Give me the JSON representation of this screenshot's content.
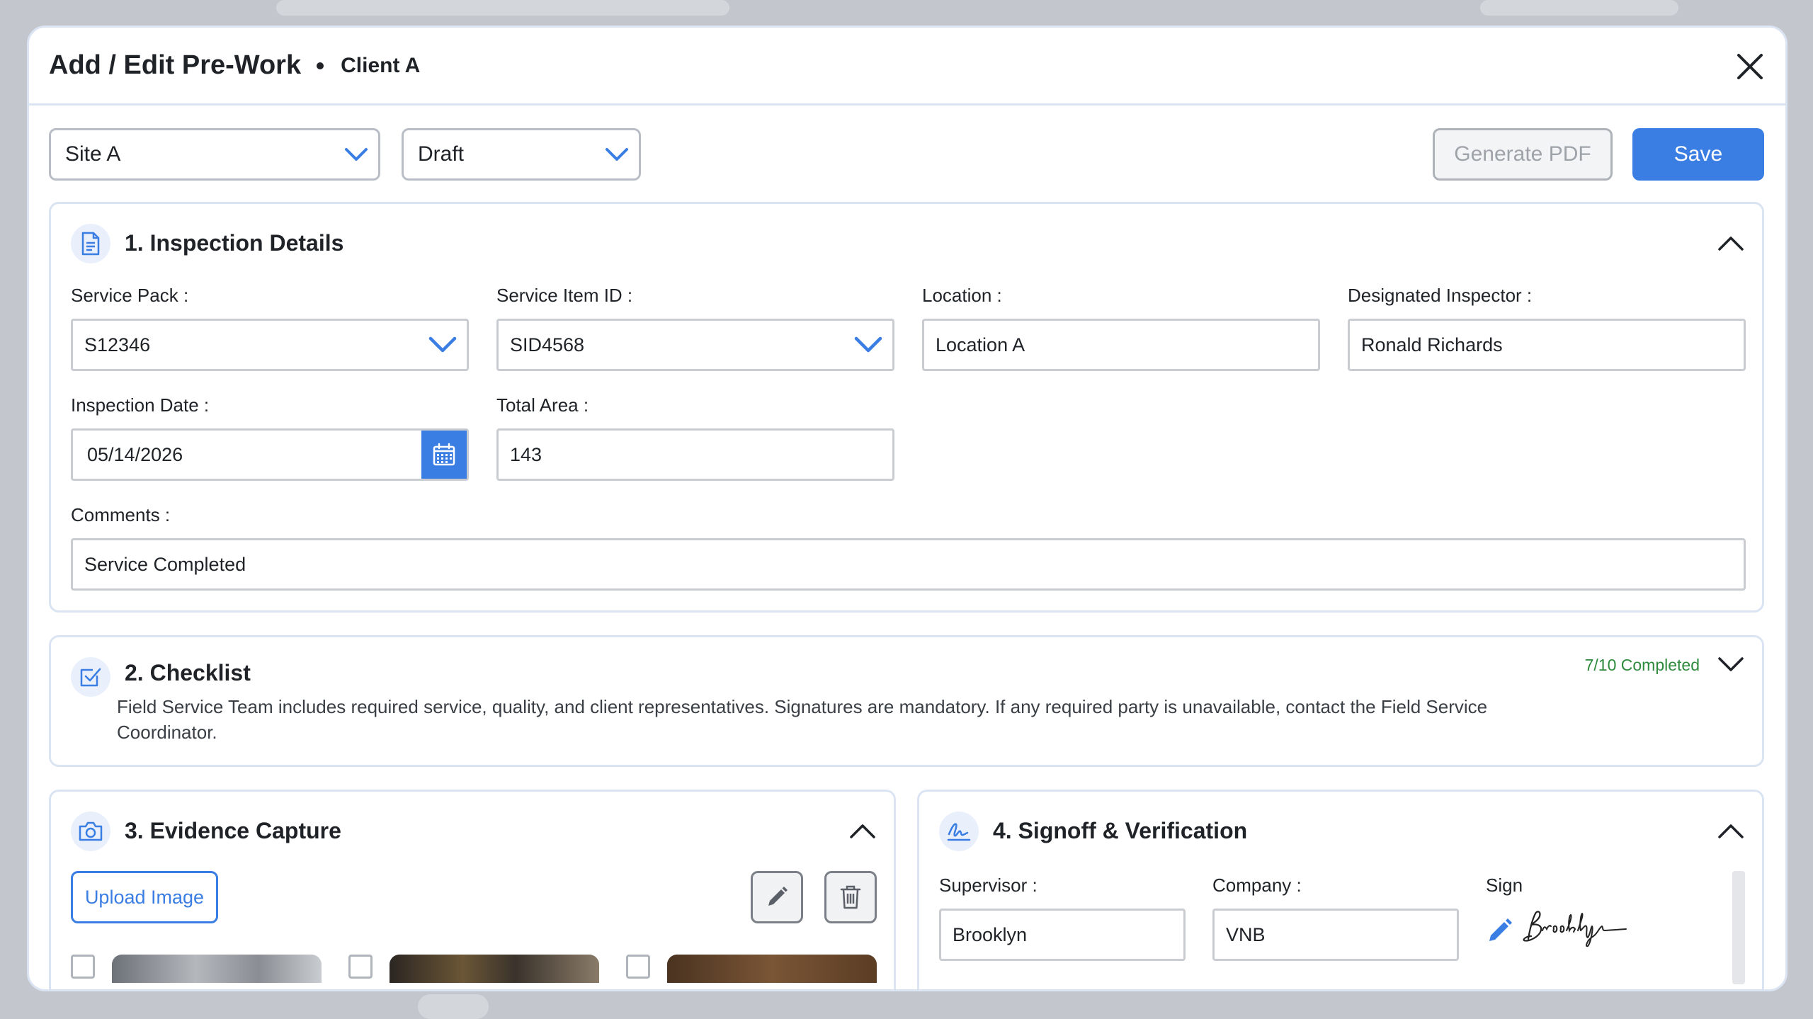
{
  "modal": {
    "title": "Add / Edit Pre-Work",
    "client": "Client A"
  },
  "toolbar": {
    "site_select": "Site A",
    "status_select": "Draft",
    "generate_pdf_label": "Generate PDF",
    "save_label": "Save"
  },
  "inspection": {
    "title": "1. Inspection Details",
    "service_pack_label": "Service Pack :",
    "service_pack_value": "S12346",
    "service_item_label": "Service Item ID :",
    "service_item_value": "SID4568",
    "location_label": "Location :",
    "location_value": "Location A",
    "inspector_label": "Designated Inspector :",
    "inspector_value": "Ronald Richards",
    "date_label": "Inspection Date :",
    "date_value": "05/14/2026",
    "area_label": "Total Area :",
    "area_value": "143",
    "comments_label": "Comments :",
    "comments_value": "Service Completed"
  },
  "checklist": {
    "title": "2. Checklist",
    "progress": "7/10 Completed",
    "completed": 7,
    "total": 10,
    "description": "Field Service Team includes required service, quality, and client representatives. Signatures are mandatory. If any required party is unavailable, contact the Field Service Coordinator."
  },
  "evidence": {
    "title": "3. Evidence Capture",
    "upload_label": "Upload Image"
  },
  "signoff": {
    "title": "4. Signoff & Verification",
    "supervisor_label": "Supervisor :",
    "supervisor_value": "Brooklyn",
    "company_label": "Company :",
    "company_value": "VNB",
    "sign_label": "Sign",
    "signature": "Brooklyn"
  },
  "colors": {
    "accent": "#3a7de3",
    "progress_green": "#2e8b3d",
    "border": "#dbe4f3"
  },
  "icons": [
    "close-icon",
    "chevron-down-icon",
    "chevron-up-icon",
    "document-icon",
    "checkbox-icon",
    "camera-icon",
    "signature-icon",
    "calendar-icon",
    "pencil-icon",
    "trash-icon"
  ]
}
